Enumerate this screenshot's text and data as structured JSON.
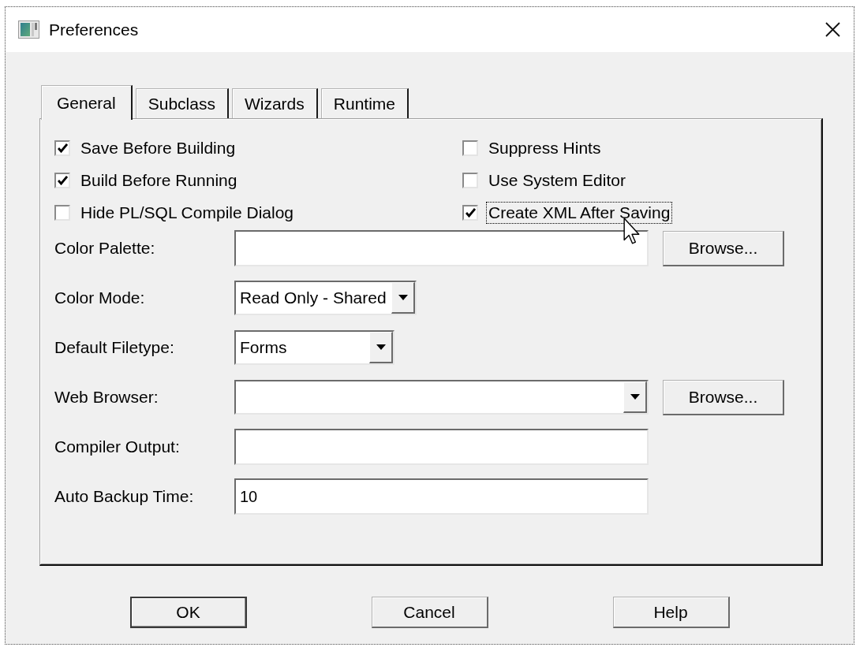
{
  "window": {
    "title": "Preferences"
  },
  "tabs": [
    {
      "label": "General",
      "selected": true
    },
    {
      "label": "Subclass",
      "selected": false
    },
    {
      "label": "Wizards",
      "selected": false
    },
    {
      "label": "Runtime",
      "selected": false
    }
  ],
  "options": [
    {
      "label": "Save Before Building",
      "checked": true,
      "focused": false
    },
    {
      "label": "Build Before Running",
      "checked": true,
      "focused": false
    },
    {
      "label": "Hide PL/SQL Compile Dialog",
      "checked": false,
      "focused": false
    },
    {
      "label": "Suppress Hints",
      "checked": false,
      "focused": false
    },
    {
      "label": "Use System Editor",
      "checked": false,
      "focused": false
    },
    {
      "label": "Create XML After Saving",
      "checked": true,
      "focused": true
    }
  ],
  "fields": [
    {
      "label": "Color Palette:",
      "kind": "text",
      "button": {
        "label": "Browse..."
      }
    },
    {
      "label": "Color Mode:",
      "kind": "dropdown",
      "value": "Read Only - Shared"
    },
    {
      "label": "Default Filetype:",
      "kind": "dropdown",
      "value": "Forms"
    },
    {
      "label": "Web Browser:",
      "kind": "dropdown",
      "button": {
        "label": "Browse..."
      }
    },
    {
      "label": "Compiler Output:",
      "kind": "text"
    },
    {
      "label": "Auto Backup Time:",
      "kind": "text",
      "value": "10"
    }
  ],
  "buttons": [
    {
      "label": "OK",
      "default": true
    },
    {
      "label": "Cancel",
      "default": false
    },
    {
      "label": "Help",
      "default": false
    }
  ]
}
